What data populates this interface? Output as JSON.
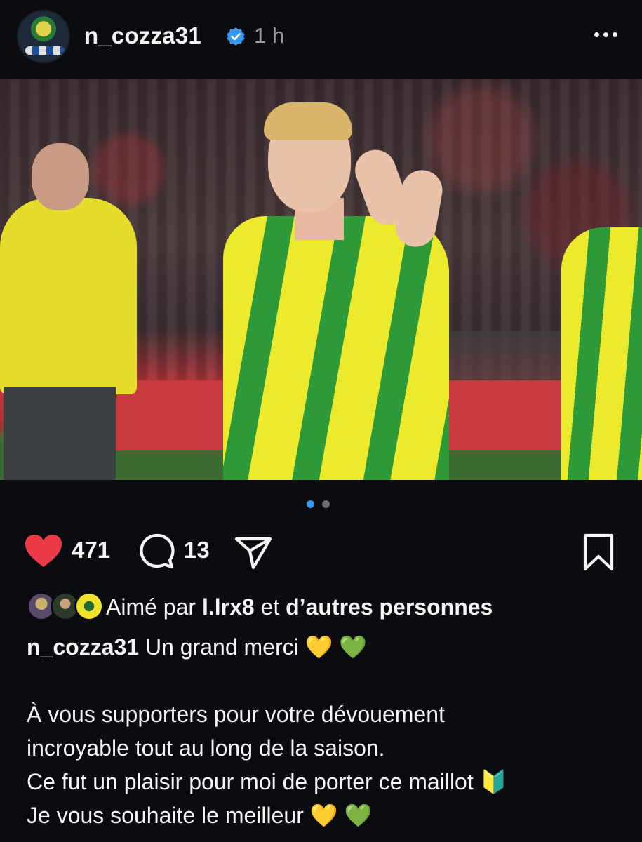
{
  "header": {
    "username": "n_cozza31",
    "time": "1 h"
  },
  "colors": {
    "background": "#0b0c10",
    "accent_blue": "#3897f0",
    "like_red": "#ed3a49"
  },
  "carousel": {
    "total": 2,
    "active_index": 0
  },
  "actions": {
    "like_count": "471",
    "comment_count": "13"
  },
  "likes": {
    "prefix": "Aimé par",
    "user": "l.lrx8",
    "middle": "et",
    "suffix": "d’autres personnes"
  },
  "caption": {
    "username": "n_cozza31",
    "line1": "Un grand merci",
    "line2": "À vous supporters pour votre dévouement",
    "line3": "incroyable tout au long de la saison.",
    "line4": "Ce fut un plaisir pour moi de porter ce maillot",
    "line5": "Je vous souhaite le meilleur",
    "emoji_yellow_heart": "💛",
    "emoji_green_heart": "💚",
    "emoji_beginner": "🔰"
  },
  "icons": {
    "verified": "verified-badge-icon",
    "more": "more-options-icon",
    "like": "heart-filled-icon",
    "comment": "comment-icon",
    "share": "paper-plane-icon",
    "save": "bookmark-icon"
  }
}
